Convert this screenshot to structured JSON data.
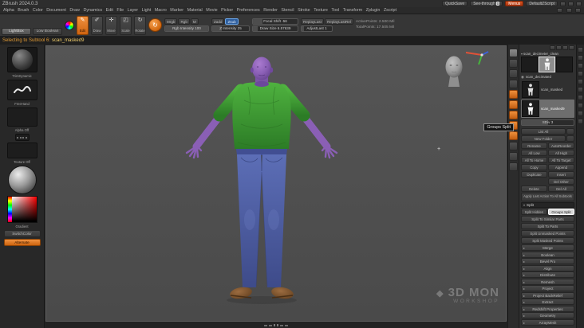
{
  "titlebar": {
    "app_title": "ZBrush 2024.0.3",
    "quicksave_label": "QuickSave",
    "see_through_label": "See-through",
    "see_through_value": "0",
    "menus_label": "Menus",
    "zscript_label": "DefaultZScript"
  },
  "menubar": {
    "items": [
      "Alpha",
      "Brush",
      "Color",
      "Document",
      "Draw",
      "Dynamics",
      "Edit",
      "File",
      "Layer",
      "Light",
      "Macro",
      "Marker",
      "Material",
      "Movie",
      "Picker",
      "Preferences",
      "Render",
      "Stencil",
      "Stroke",
      "Texture",
      "Tool",
      "Transform",
      "Zplugin",
      "Zscript"
    ]
  },
  "toolbar": {
    "lightbox_label": "LightBox",
    "low_boolean_label": "Low Boolean",
    "tools": [
      "Edit",
      "Draw",
      "Move",
      "Scale",
      "Rotate"
    ],
    "mrgb_label": "Mrgb",
    "rgb_label": "Rgb",
    "m_label": "M",
    "zadd_label": "Zadd",
    "zsub_label": "Zsub",
    "rgb_intensity": "Rgb Intensity 100",
    "z_intensity": "Z Intensity 25",
    "focal_shift": "Focal Shift -56",
    "draw_size": "Draw Size 6.57639",
    "replay_last": "ReplayLast",
    "replay_last_rel": "ReplayLastRel",
    "adjust_last": "AdjustLast 1",
    "active_points": "ActivePoints: 2.500 Mil",
    "total_points": "TotalPoints: 17.505 Mil"
  },
  "status": {
    "message": "Selecting to Subtool 6:",
    "subtool_name": "scan_masked9"
  },
  "left_tray": {
    "brush_name": "TrimDynamic",
    "stroke_name": "FreeHand",
    "alpha_label": "Alpha Off",
    "texture_label": "Texture Off",
    "gradient_label": "Gradient",
    "switch_color_label": "SwitchColor",
    "alternate_label": "Alternate"
  },
  "subtool_panel": {
    "folder_name": "scan_decimeter_clean",
    "item_decimated": "scan_decimated",
    "item_masked": "scan_masked",
    "item_masked9": "scan_masked9",
    "sdiv_label": "SDiv 3"
  },
  "tool_panel": {
    "rows": [
      {
        "l": "List All",
        "r": ""
      },
      {
        "l": "New Folder",
        "r": ""
      },
      {
        "l": "Rename",
        "r": "AutoReorder"
      },
      {
        "l": "All Low",
        "r": "All High"
      },
      {
        "l": "All To Home",
        "r": "All To Target"
      },
      {
        "l": "Copy",
        "r": "Append"
      },
      {
        "l": "Duplicate",
        "r": "Insert"
      },
      {
        "l": "",
        "r": "Del Other"
      },
      {
        "l": "Delete",
        "r": "Del All"
      }
    ],
    "apply_last_label": "Apply Last Action To All Subtools",
    "split_header": "Split",
    "split_hidden_label": "Split Hidden",
    "groups_split_label": "Groups Split",
    "split_rows": [
      "Split To Similar Parts",
      "Split To Parts",
      "Split Unmasked Points",
      "Split Masked Points"
    ],
    "sections": [
      "Merge",
      "Boolean",
      "Bevel Pro",
      "Align",
      "Distribute",
      "Remesh",
      "Project",
      "Project BackRelief",
      "Extract",
      "Redshift Properties",
      "Geometry",
      "ArrayMesh"
    ]
  },
  "canvas": {
    "tooltip": "Groups Split",
    "watermark_line1": "3D MON",
    "watermark_line2": "WORKSHOP"
  },
  "icons": {
    "collapse_arrow": "▸",
    "expand_arrow": "▾",
    "eye": "◉",
    "edit_tool": "✎",
    "draw_tool": "✐",
    "move_tool": "✛",
    "scale_tool": "◰",
    "rotate_tool": "↻",
    "rotate_ring": "↻",
    "crosshair": "+",
    "diamond": "◆"
  },
  "colors": {
    "accent_orange": "#e0761f",
    "menus_red": "#c03a1a",
    "zsub_blue": "#2f5f9e",
    "mask_purple": "#8a5fb5",
    "shirt_green": "#3da437",
    "jeans_blue": "#5668b2",
    "canvas_gray": "#4e4e4e"
  }
}
